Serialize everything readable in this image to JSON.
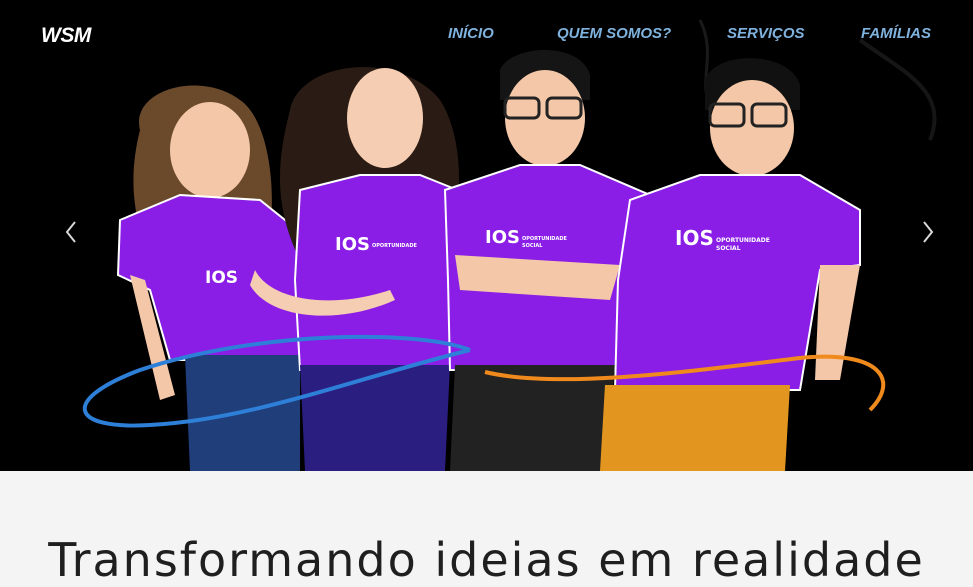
{
  "navbar": {
    "brand": "WSM",
    "links": [
      "INÍCIO",
      "QUEM SOMOS?",
      "SERVIÇOS",
      "FAMÍLIAS"
    ]
  },
  "carousel": {
    "prev_icon": "chevron-left-icon",
    "next_icon": "chevron-right-icon",
    "shirt_logo": "IOS",
    "shirt_sub": "OPORTUNIDADE SOCIAL"
  },
  "headline": "Transformando ideias em realidade",
  "colors": {
    "nav_link": "#7fb2de",
    "hero_bg": "#000000",
    "shirt": "#8a1ee6",
    "swoosh_blue": "#2e7fd8",
    "swoosh_orange": "#f08a1c"
  }
}
